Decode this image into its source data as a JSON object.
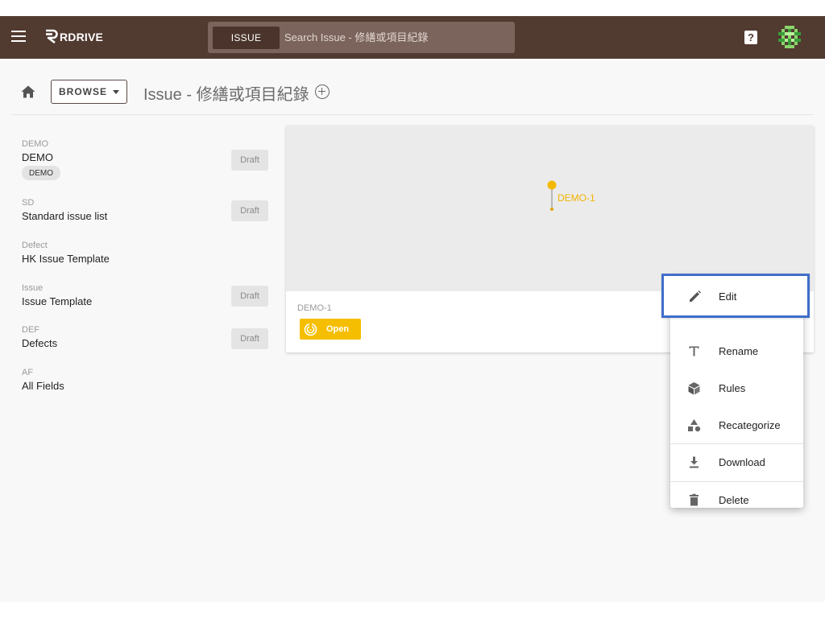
{
  "topbar": {
    "logo_text": "RDRIVE",
    "search_chip": "ISSUE",
    "search_placeholder": "Search Issue - 修繕或項目紀錄",
    "help_glyph": "?"
  },
  "header": {
    "browse_label": "BROWSE",
    "page_title": "Issue - 修繕或項目紀錄"
  },
  "list": [
    {
      "code": "DEMO",
      "name": "DEMO",
      "tag": "DEMO",
      "draft": "Draft"
    },
    {
      "code": "SD",
      "name": "Standard issue list",
      "draft": "Draft"
    },
    {
      "code": "Defect",
      "name": "HK Issue Template"
    },
    {
      "code": "Issue",
      "name": "Issue Template",
      "draft": "Draft"
    },
    {
      "code": "DEF",
      "name": "Defects",
      "draft": "Draft"
    },
    {
      "code": "AF",
      "name": "All Fields"
    }
  ],
  "card": {
    "pin_label": "DEMO-1",
    "code": "DEMO-1",
    "status": "Open"
  },
  "menu": {
    "items": [
      {
        "label": "Edit",
        "icon": "pencil-icon"
      },
      {
        "label": "Rename",
        "icon": "text-icon"
      },
      {
        "label": "Rules",
        "icon": "cube-icon"
      },
      {
        "label": "Recategorize",
        "icon": "shapes-icon"
      },
      {
        "label": "Download",
        "icon": "download-icon"
      },
      {
        "label": "Delete",
        "icon": "trash-icon"
      }
    ]
  },
  "colors": {
    "topbar": "#513a30",
    "status_open": "#f5be00",
    "highlight": "#3f6ec9"
  }
}
